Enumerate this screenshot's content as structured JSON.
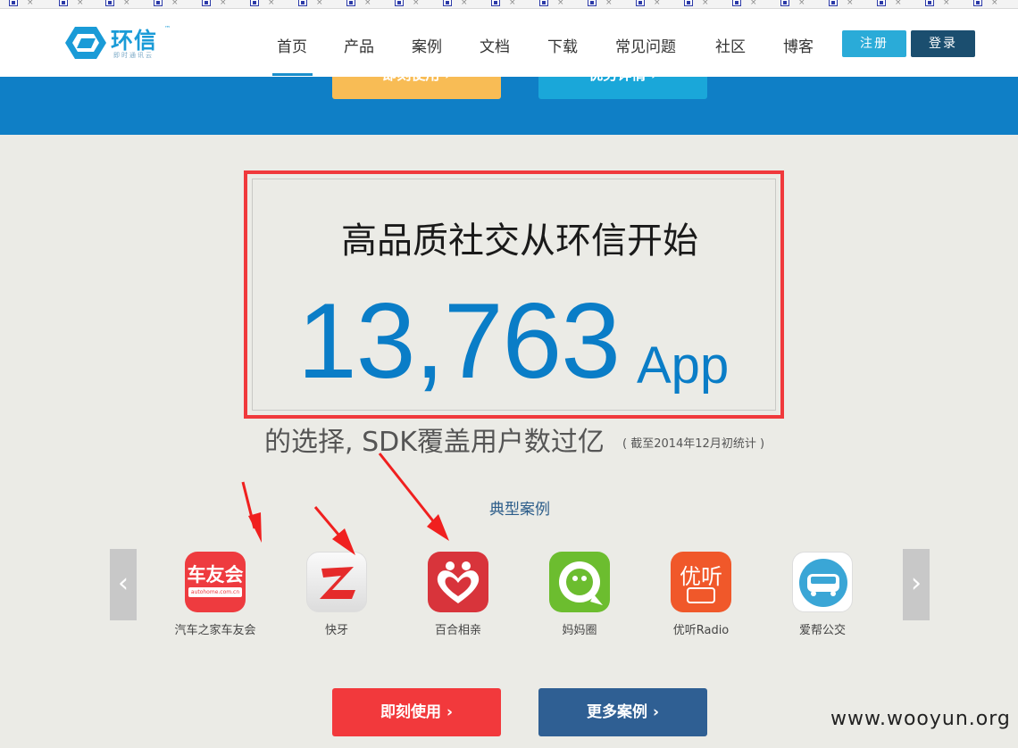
{
  "logo": {
    "text": "环信",
    "tm": "™",
    "subtitle": "即时通讯云"
  },
  "nav": {
    "items": [
      "首页",
      "产品",
      "案例",
      "文档",
      "下载",
      "常见问题",
      "社区",
      "博客"
    ],
    "register": "注册",
    "login": "登录"
  },
  "hero": {
    "use_now": "即刻使用 ›",
    "advantages": "优势详情 ›"
  },
  "headline": "高品质社交从环信开始",
  "stat": {
    "number": "13,763",
    "unit": "App"
  },
  "subline": "的选择, SDK覆盖用户数过亿",
  "subline_note": "( 截至2014年12月初统计 )",
  "cases_title": "典型案例",
  "carousel": {
    "prev": "‹",
    "next": "›"
  },
  "apps": [
    {
      "label": "汽车之家车友会",
      "icon_text": "车友会",
      "icon_sub": "autohome.com.cn"
    },
    {
      "label": "快牙"
    },
    {
      "label": "百合相亲"
    },
    {
      "label": "妈妈圈"
    },
    {
      "label": "优听Radio",
      "icon_text": "优听"
    },
    {
      "label": "爱帮公交"
    }
  ],
  "cta": {
    "use_now": "即刻使用 ›",
    "more_cases": "更多案例 ›"
  },
  "watermark": "www.wooyun.org",
  "colors": {
    "brand_blue": "#0f7fc6",
    "stat_blue": "#0a7dc7",
    "highlight_red": "#f0393c",
    "cta_red": "#f2393c",
    "cta_navy": "#2f5f93"
  }
}
